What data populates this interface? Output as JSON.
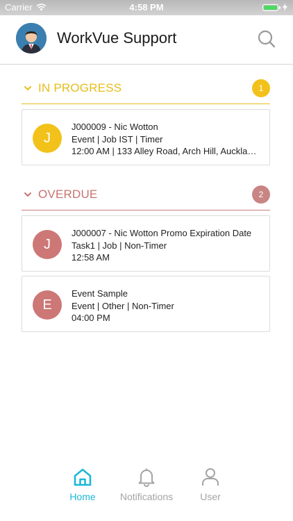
{
  "status_bar": {
    "carrier": "Carrier",
    "time": "4:58 PM"
  },
  "header": {
    "title": "WorkVue Support",
    "avatar_icon": "user-avatar",
    "search_icon": "search-icon"
  },
  "sections": [
    {
      "title": "IN PROGRESS",
      "count": "1",
      "color": "#f2c21b",
      "items": [
        {
          "initial": "J",
          "line1": "J000009 - Nic Wotton",
          "line2": "Event | Job IST | Timer",
          "line3": "12:00 AM | 133 Alley Road, Arch Hill, Aucklan…"
        }
      ]
    },
    {
      "title": "OVERDUE",
      "count": "2",
      "color": "#cd7777",
      "items": [
        {
          "initial": "J",
          "line1": "J000007 - Nic Wotton Promo Expiration Date",
          "line2": "Task1 | Job | Non-Timer",
          "line3": "12:58 AM"
        },
        {
          "initial": "E",
          "line1": "Event Sample",
          "line2": "Event | Other | Non-Timer",
          "line3": "04:00 PM"
        }
      ]
    }
  ],
  "tabs": [
    {
      "label": "Home",
      "icon": "home-icon",
      "active": true,
      "color": "#1db8d6"
    },
    {
      "label": "Notifications",
      "icon": "bell-icon",
      "active": false,
      "color": "#a3a3a3"
    },
    {
      "label": "User",
      "icon": "user-icon",
      "active": false,
      "color": "#a3a3a3"
    }
  ]
}
